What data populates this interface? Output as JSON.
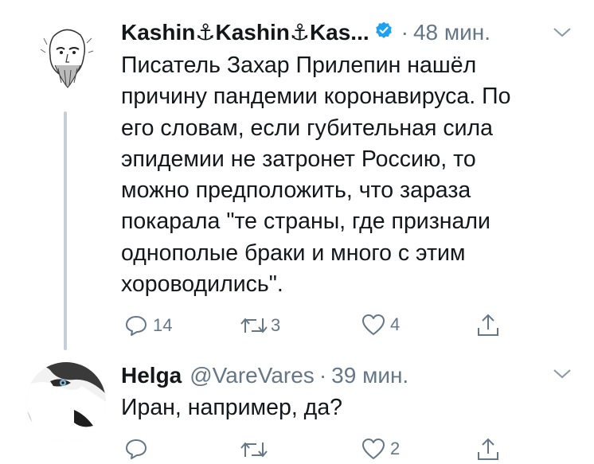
{
  "tweets": [
    {
      "display_name_parts": [
        "Kashin",
        "⚓",
        "Kashin",
        "⚓",
        "Kas..."
      ],
      "verified": true,
      "separator": "·",
      "time": "48 мин.",
      "text_lines": [
        "Писатель Захар Прилепин нашёл",
        "причину пандемии коронавируса. По",
        "его словам, если губительная сила",
        "эпидемии не затронет Россию, то",
        "можно предположить, что зараза",
        "покарала \"те страны, где признали",
        "однополые браки и много с этим",
        "хороводились\"."
      ],
      "actions": {
        "reply_count": "14",
        "retweet_count": "3",
        "like_count": "4",
        "share_count": ""
      }
    },
    {
      "display_name": "Helga",
      "handle": "@VareVares",
      "separator": "·",
      "time": "39 мин.",
      "text_lines": [
        "Иран, например, да?"
      ],
      "actions": {
        "reply_count": "",
        "retweet_count": "",
        "like_count": "2",
        "share_count": ""
      }
    }
  ],
  "colors": {
    "text": "#14171a",
    "muted": "#657786",
    "verified": "#1da1f2",
    "thread_line": "#c4cfd6"
  },
  "icons": [
    "reply-icon",
    "retweet-icon",
    "like-icon",
    "share-icon",
    "chevron-down-icon",
    "verified-badge-icon",
    "anchor-icon"
  ]
}
